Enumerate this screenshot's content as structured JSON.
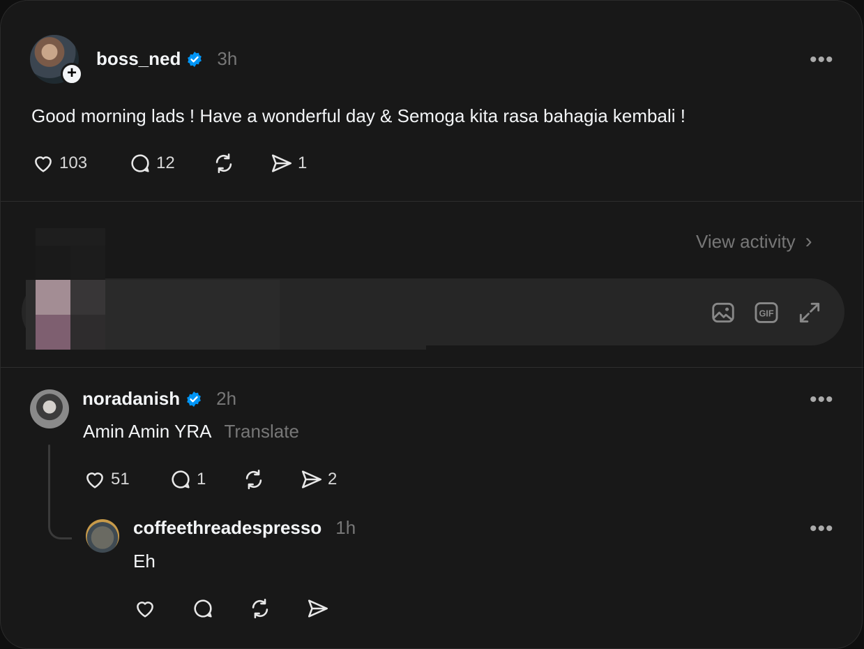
{
  "post": {
    "username": "boss_ned",
    "time": "3h",
    "text": "Good morning lads ! Have a wonderful day & Semoga kita rasa bahagia kembali !",
    "likes": "103",
    "comments": "12",
    "shares": "1",
    "more_label": "•••"
  },
  "activity": {
    "view_label": "View activity",
    "chevron": "›"
  },
  "composer": {
    "icons": [
      "image-icon",
      "gif-icon",
      "expand-icon"
    ],
    "gif_label": "GIF"
  },
  "replies": [
    {
      "username": "noradanish",
      "time": "2h",
      "text": "Amin Amin YRA",
      "translate_label": "Translate",
      "likes": "51",
      "comments": "1",
      "shares": "2",
      "more_label": "•••"
    },
    {
      "username": "coffeethreadespresso",
      "time": "1h",
      "text": "Eh",
      "more_label": "•••"
    }
  ],
  "colors": {
    "background": "#181818",
    "verified": "#0095f6",
    "muted": "#777777"
  }
}
